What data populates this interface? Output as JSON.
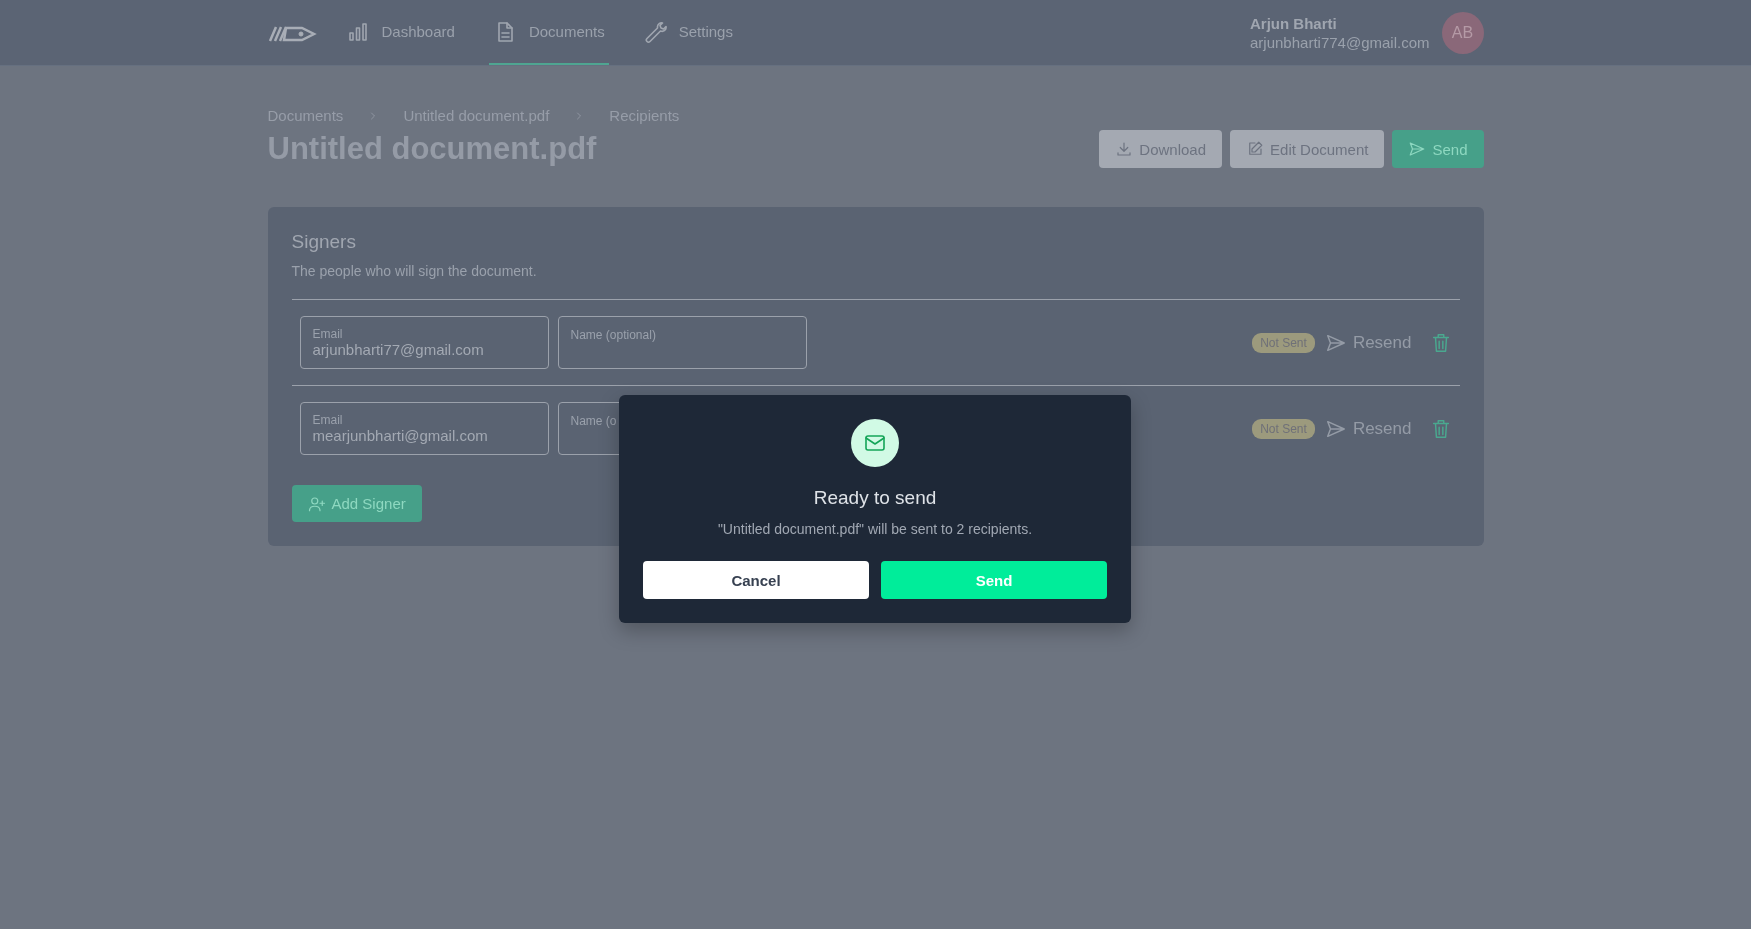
{
  "header": {
    "nav": [
      {
        "label": "Dashboard",
        "selected": false
      },
      {
        "label": "Documents",
        "selected": true
      },
      {
        "label": "Settings",
        "selected": false
      }
    ],
    "user": {
      "name": "Arjun Bharti",
      "email": "arjunbharti774@gmail.com",
      "initials": "AB"
    }
  },
  "breadcrumb": [
    "Documents",
    "Untitled document.pdf",
    "Recipients"
  ],
  "title": "Untitled document.pdf",
  "actions": [
    {
      "label": "Download",
      "kind": "download"
    },
    {
      "label": "Edit Document",
      "kind": "edit"
    },
    {
      "label": "Send",
      "kind": "send"
    }
  ],
  "signers": {
    "title": "Signers",
    "description": "The people who will sign the document.",
    "rows": [
      {
        "email_label": "Email",
        "email": "arjunbharti77@gmail.com",
        "name_placeholder": "Name (optional)",
        "status": "Not Sent",
        "resend": "Resend"
      },
      {
        "email_label": "Email",
        "email": "mearjunbharti@gmail.com",
        "name_placeholder": "Name (o",
        "status": "Not Sent",
        "resend": "Resend"
      }
    ],
    "add_button": "Add Signer"
  },
  "modal": {
    "title": "Ready to send",
    "message": "\"Untitled document.pdf\" will be sent to 2 recipients.",
    "buttons": [
      {
        "label": "Cancel",
        "kind": "secondary"
      },
      {
        "label": "Send",
        "kind": "primary"
      }
    ]
  }
}
